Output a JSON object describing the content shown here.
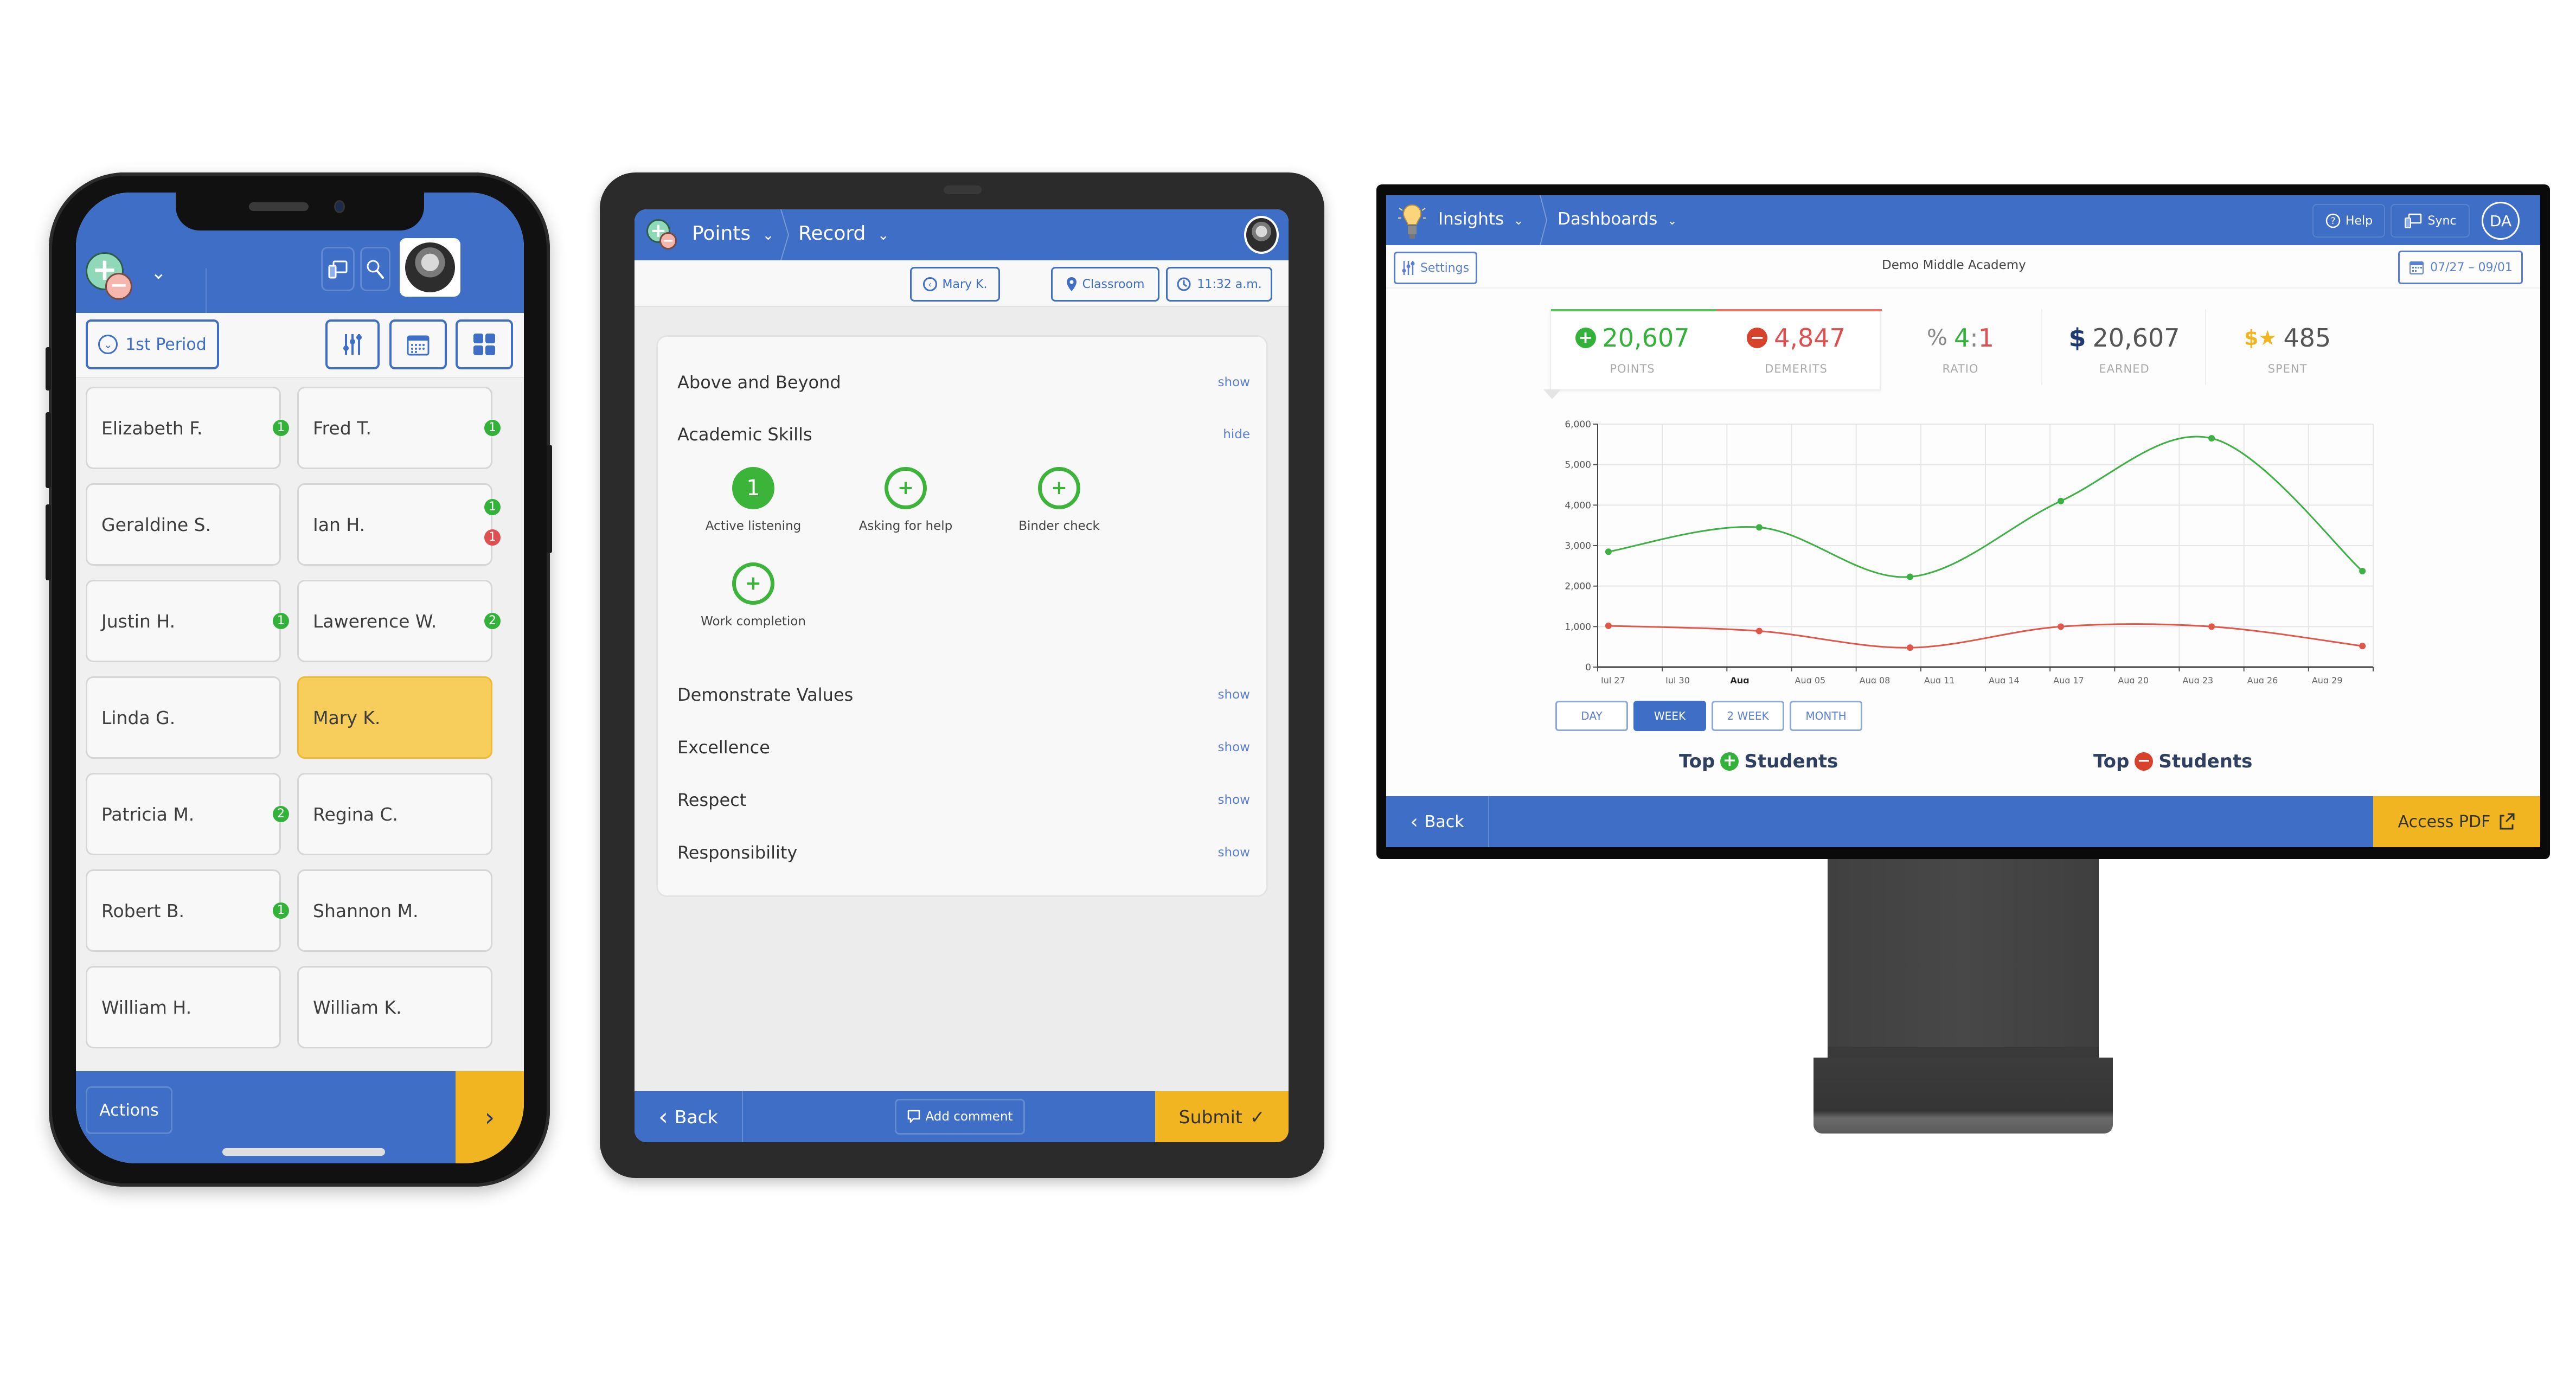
{
  "colors": {
    "brand_blue": "#3e6ec6",
    "accent_yellow": "#f0b521",
    "selected_card": "#f7cd5b",
    "points_green": "#33b23a",
    "demerits_red": "#df4f4f",
    "link_blue": "#5b80cf"
  },
  "phone": {
    "icons": {
      "logo": "points-plus-minus-logo",
      "header_dropdown": "chevron-down-icon",
      "sync": "devices-sync-icon",
      "search": "search-icon",
      "avatar": "user-avatar-photo",
      "filter": "sliders-icon",
      "calendar": "calendar-icon",
      "grid": "grid-view-icon",
      "next": "chevron-right-icon"
    },
    "period_selector": {
      "label": "1st Period",
      "icon": "chevron-down-circle-icon"
    },
    "students": [
      {
        "name": "Elizabeth F.",
        "badges": [
          {
            "type": "points",
            "count": "1"
          }
        ],
        "selected": false
      },
      {
        "name": "Fred T.",
        "badges": [
          {
            "type": "points",
            "count": "1"
          }
        ],
        "selected": false
      },
      {
        "name": "Geraldine S.",
        "badges": [],
        "selected": false
      },
      {
        "name": "Ian H.",
        "badges": [
          {
            "type": "points",
            "count": "1"
          },
          {
            "type": "demerits",
            "count": "1"
          }
        ],
        "selected": false
      },
      {
        "name": "Justin H.",
        "badges": [
          {
            "type": "points",
            "count": "1"
          }
        ],
        "selected": false
      },
      {
        "name": "Lawerence W.",
        "badges": [
          {
            "type": "points",
            "count": "2"
          }
        ],
        "selected": false
      },
      {
        "name": "Linda G.",
        "badges": [],
        "selected": false
      },
      {
        "name": "Mary K.",
        "badges": [],
        "selected": true
      },
      {
        "name": "Patricia M.",
        "badges": [
          {
            "type": "points",
            "count": "2"
          }
        ],
        "selected": false
      },
      {
        "name": "Regina C.",
        "badges": [],
        "selected": false
      },
      {
        "name": "Robert B.",
        "badges": [
          {
            "type": "points",
            "count": "1"
          }
        ],
        "selected": false
      },
      {
        "name": "Shannon M.",
        "badges": [],
        "selected": false
      },
      {
        "name": "William H.",
        "badges": [],
        "selected": false
      },
      {
        "name": "William K.",
        "badges": [],
        "selected": false
      }
    ],
    "footer": {
      "actions_label": "Actions",
      "next_icon": "›"
    }
  },
  "tablet": {
    "header": {
      "app_label": "Points",
      "section_label": "Record",
      "dropdown_icon": "⌄"
    },
    "chips": {
      "student": "Mary K.",
      "location": "Classroom",
      "time": "11:32 a.m."
    },
    "categories": [
      {
        "title": "Above and Beyond",
        "toggle": "show"
      },
      {
        "title": "Academic Skills",
        "toggle": "hide"
      },
      {
        "title": "Demonstrate Values",
        "toggle": "show"
      },
      {
        "title": "Excellence",
        "toggle": "show"
      },
      {
        "title": "Respect",
        "toggle": "show"
      },
      {
        "title": "Responsibility",
        "toggle": "show"
      }
    ],
    "behaviors": [
      {
        "label": "Active listening",
        "count": "1",
        "selected": true
      },
      {
        "label": "Asking for help",
        "count": "+",
        "selected": false
      },
      {
        "label": "Binder check",
        "count": "+",
        "selected": false
      },
      {
        "label": "Work completion",
        "count": "+",
        "selected": false
      }
    ],
    "footer": {
      "back_label": "Back",
      "comment_label": "Add comment",
      "submit_label": "Submit",
      "submit_icon": "✓",
      "back_icon": "‹"
    }
  },
  "monitor": {
    "header": {
      "app_label": "Insights",
      "section_label": "Dashboards",
      "help_label": "Help",
      "sync_label": "Sync",
      "user_initials": "DA"
    },
    "sub": {
      "settings_label": "Settings",
      "school_name": "Demo Middle Academy",
      "date_range": "07/27 – 09/01"
    },
    "stats": [
      {
        "key": "points",
        "value": "20,607",
        "label": "POINTS",
        "icon": "+",
        "color": "#33b23a"
      },
      {
        "key": "demerits",
        "value": "4,847",
        "label": "DEMERITS",
        "icon": "−",
        "color": "#df4f4f"
      },
      {
        "key": "ratio",
        "value_left": "4",
        "value_sep": ":",
        "value_right": "1",
        "label": "RATIO",
        "icon": "%"
      },
      {
        "key": "earned",
        "value": "20,607",
        "label": "EARNED",
        "icon": "$"
      },
      {
        "key": "spent",
        "value": "485",
        "label": "SPENT",
        "icon": "$★"
      }
    ],
    "period_tabs": [
      {
        "label": "DAY",
        "active": false
      },
      {
        "label": "WEEK",
        "active": true
      },
      {
        "label": "2 WEEK",
        "active": false
      },
      {
        "label": "MONTH",
        "active": false
      }
    ],
    "top_lists": [
      {
        "prefix": "Top",
        "suffix": "Students",
        "icon": "+",
        "color": "#33b23a"
      },
      {
        "prefix": "Top",
        "suffix": "Students",
        "icon": "−",
        "color": "#df4f4f"
      }
    ],
    "footer": {
      "back_label": "Back",
      "back_icon": "‹",
      "pdf_label": "Access PDF",
      "pdf_icon": "external-link-icon"
    }
  },
  "chart_data": {
    "type": "line",
    "title": "",
    "xlabel": "",
    "ylabel": "",
    "x_unit": "days since Jul 27",
    "xlim": [
      0,
      36
    ],
    "ylim": [
      0,
      6000
    ],
    "grid": true,
    "smooth": true,
    "y_ticks": [
      0,
      1000,
      2000,
      3000,
      4000,
      5000,
      6000
    ],
    "y_tick_labels": [
      "0",
      "1,000",
      "2,000",
      "3,000",
      "4,000",
      "5,000",
      "6,000"
    ],
    "x_ticks": [
      0,
      3,
      6,
      9,
      12,
      15,
      18,
      21,
      24,
      27,
      30,
      33,
      36
    ],
    "x_tick_labels": [
      "Jul 27",
      "Jul 30",
      "Aug",
      "Aug 05",
      "Aug 08",
      "Aug 11",
      "Aug 14",
      "Aug 17",
      "Aug 20",
      "Aug 23",
      "Aug 26",
      "Aug 29",
      ""
    ],
    "bold_tick_labels": [
      "Aug"
    ],
    "x": [
      0.5,
      7.5,
      14.5,
      21.5,
      28.5,
      35.5
    ],
    "series": [
      {
        "name": "Points",
        "color": "#3cb043",
        "values": [
          2850,
          3450,
          2230,
          4100,
          5650,
          2370
        ]
      },
      {
        "name": "Demerits",
        "color": "#e0574a",
        "values": [
          1020,
          890,
          480,
          1000,
          1000,
          520
        ]
      }
    ]
  }
}
